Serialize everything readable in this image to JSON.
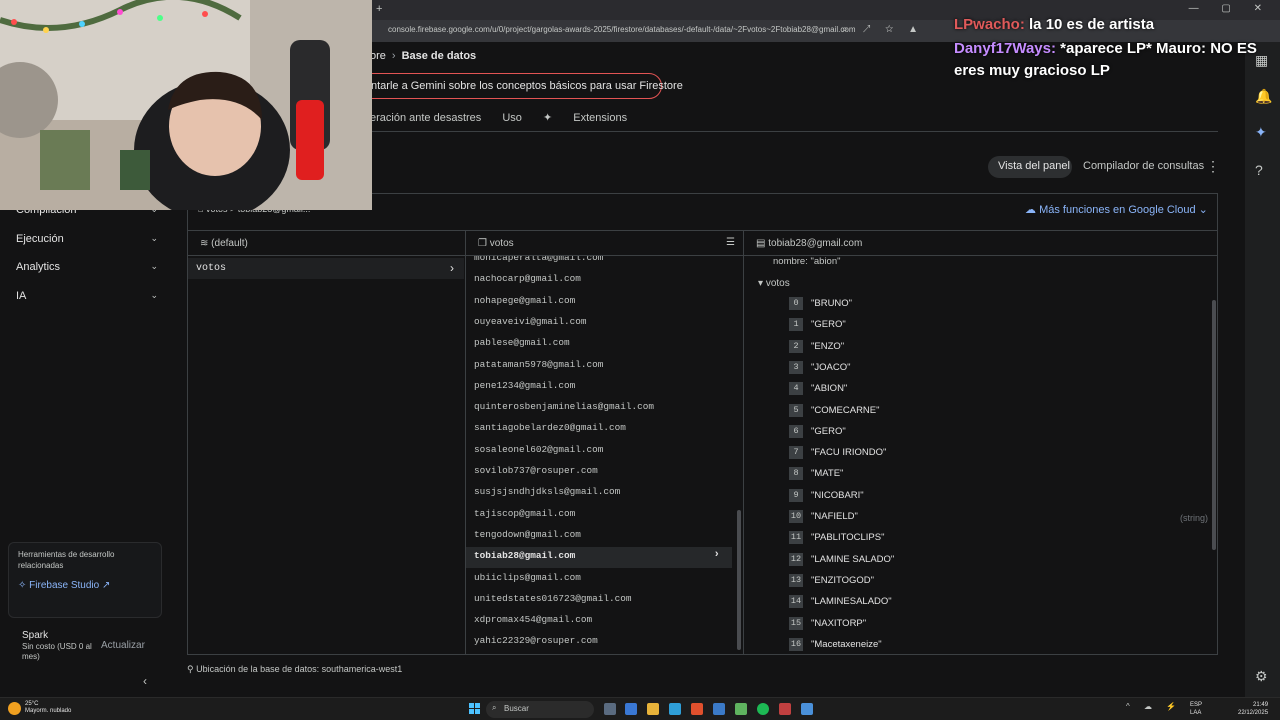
{
  "browser": {
    "url": "console.firebase.google.com/u/0/project/gargolas-awards-2025/firestore/databases/-default-/data/~2Fvotos~2Ftobiab28@gmail.com",
    "new_tab": "+",
    "window_controls": "—  ▢  ✕"
  },
  "header": {
    "breadcrumb_prev": "ore",
    "breadcrumb_current": "Base de datos",
    "gemini_prompt": "ntarle a Gemini sobre los conceptos básicos para usar Firestore",
    "tabs": [
      "eración ante desastres",
      "Uso",
      "Extensions"
    ],
    "view_panel": "Vista del panel",
    "query_builder": "Compilador de consultas"
  },
  "sidebar": {
    "groups": [
      "Compilación",
      "Ejecución",
      "Analytics",
      "IA"
    ],
    "tools_title": "Herramientas de desarrollo relacionadas",
    "studio_link": "Firebase Studio",
    "plan_name": "Spark",
    "plan_desc": "Sin costo (USD 0 al mes)",
    "upgrade": "Actualizar"
  },
  "panel": {
    "breadcrumb": "votos  >  tobiab28@gmail...",
    "more_cloud": "Más funciones en Google Cloud",
    "col1_title": "(default)",
    "col2_title": "votos",
    "col3_title": "tobiab28@gmail.com",
    "collection_selected": "votos",
    "documents": [
      "monicaperalta@gmail.com",
      "nachocarp@gmail.com",
      "nohapege@gmail.com",
      "ouyeaveivi@gmail.com",
      "pablese@gmail.com",
      "patataman5978@gmail.com",
      "pene1234@gmail.com",
      "quinterosbenjaminelias@gmail.com",
      "santiagobelardez0@gmail.com",
      "sosaleonel602@gmail.com",
      "sovilob737@rosuper.com",
      "susjsjsndhjdksls@gmail.com",
      "tajiscop@gmail.com",
      "tengodown@gmail.com",
      "tobiab28@gmail.com",
      "ubiiclips@gmail.com",
      "unitedstates016723@gmail.com",
      "xdpromax454@gmail.com",
      "yahic22329@rosuper.com"
    ],
    "selected_document": "tobiab28@gmail.com",
    "field_nombre": "nombre: \"abion\"",
    "field_votos": "votos",
    "votes": [
      "\"BRUNO\"",
      "\"GERO\"",
      "\"ENZO\"",
      "\"JOACO\"",
      "\"ABION\"",
      "\"COMECARNE\"",
      "\"GERO\"",
      "\"FACU IRIONDO\"",
      "\"MATE\"",
      "\"NICOBARI\"",
      "\"NAFIELD\"",
      "\"PABLITOCLIPS\"",
      "\"LAMINE SALADO\"",
      "\"ENZITOGOD\"",
      "\"LAMINESALADO\"",
      "\"NAXITORP\"",
      "\"Macetaxeneize\""
    ],
    "type_tag": "(string)",
    "location": "Ubicación de la base de datos: southamerica-west1"
  },
  "chat": {
    "messages": [
      {
        "user": "LPwacho:",
        "text": " la 10 es de artista",
        "color": "#e05a5a"
      },
      {
        "user": "Danyf17Ways:",
        "text": " *aparece LP* Mauro: NO ES eres muy gracioso LP",
        "color": "#c58cff"
      }
    ]
  },
  "taskbar": {
    "weather_temp": "25°C",
    "weather_desc": "Mayorm. nublado",
    "search": "Buscar",
    "lang_top": "ESP",
    "lang_bottom": "LAA",
    "time": "21:49",
    "date": "22/12/2025"
  },
  "colors": {
    "accent": "#8ab4f8",
    "gemini_border": "#e25454",
    "background": "#131314"
  },
  "icons": {
    "rail": [
      "apps-icon",
      "bell-icon",
      "gemini-icon",
      "help-icon",
      "settings-icon"
    ]
  }
}
